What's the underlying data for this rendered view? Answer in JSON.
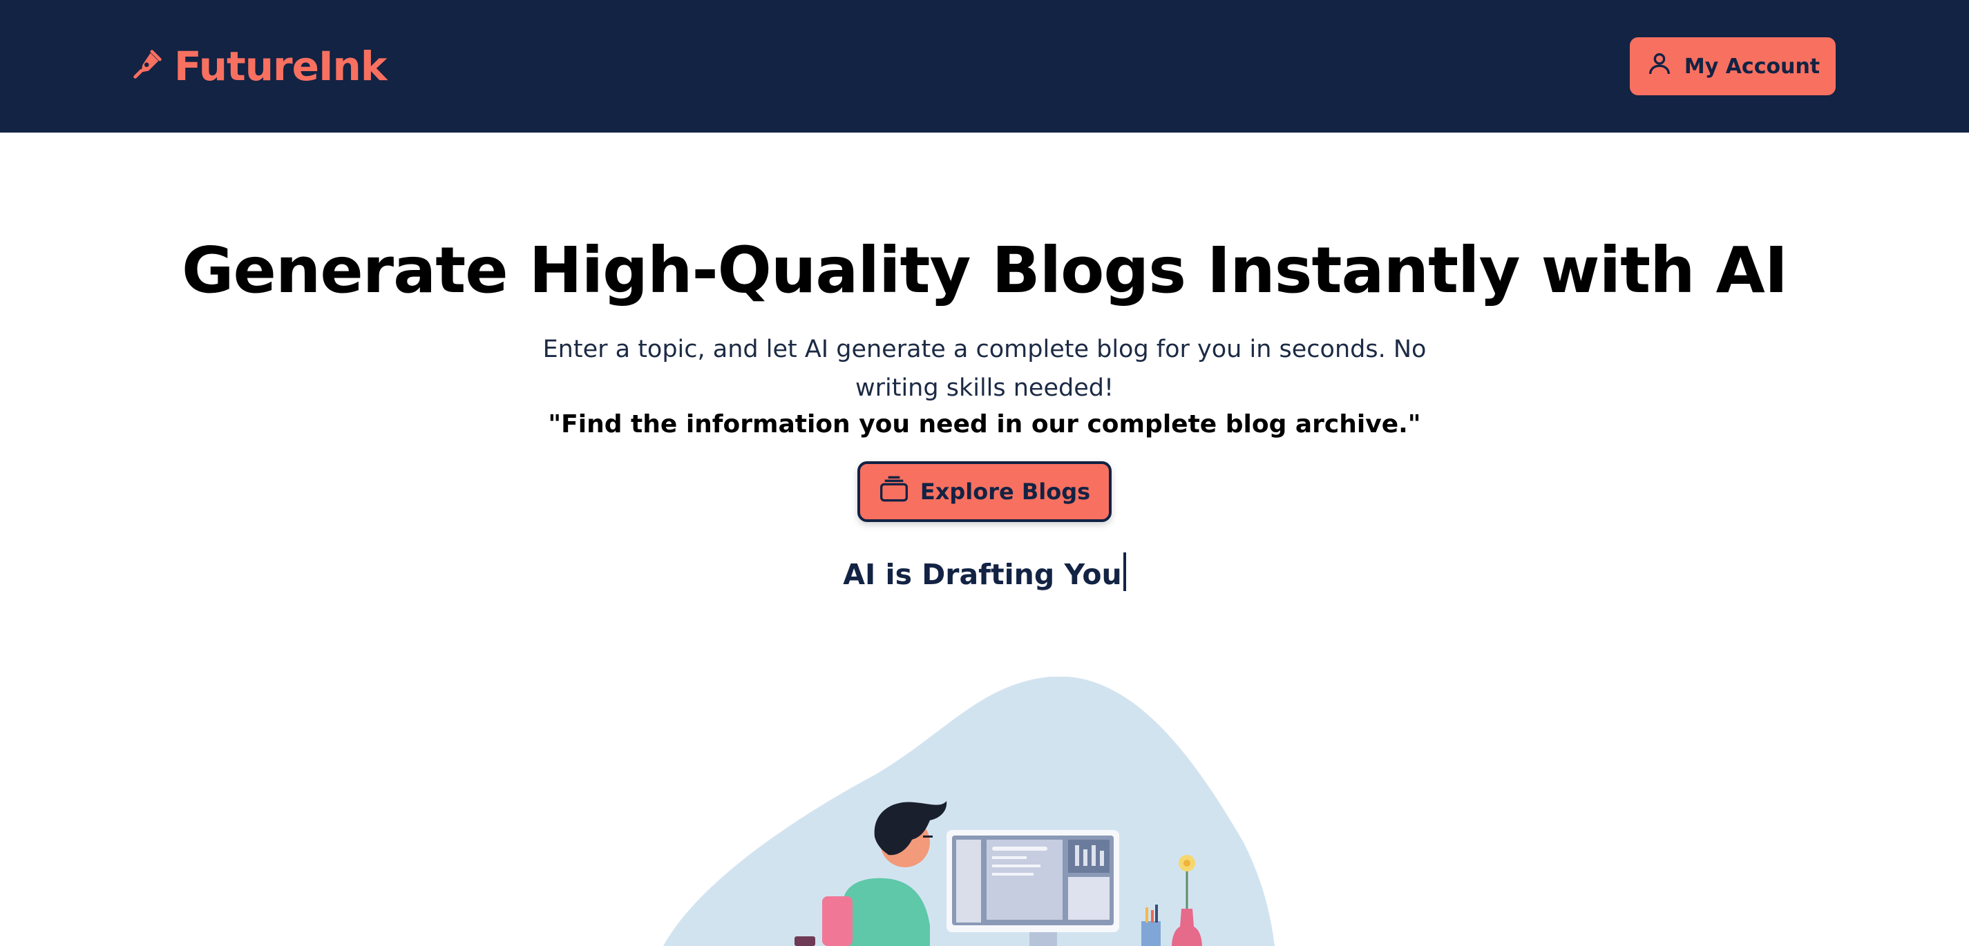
{
  "navbar": {
    "brand_name": "FutureInk",
    "brand_icon": "pen-nib-icon",
    "account_label": "My Account",
    "account_icon": "user-icon"
  },
  "hero": {
    "title": "Generate High-Quality Blogs Instantly with AI",
    "subtitle": "Enter a topic, and let AI generate a complete blog for you in seconds. No writing skills needed!",
    "quote": "\"Find the information you need in our complete blog archive.\"",
    "explore_label": "Explore Blogs",
    "explore_icon": "stack-icon",
    "typing_text": "AI is Drafting You"
  },
  "colors": {
    "navy": "#122344",
    "coral": "#f87060",
    "blob": "#d2e3f0"
  }
}
